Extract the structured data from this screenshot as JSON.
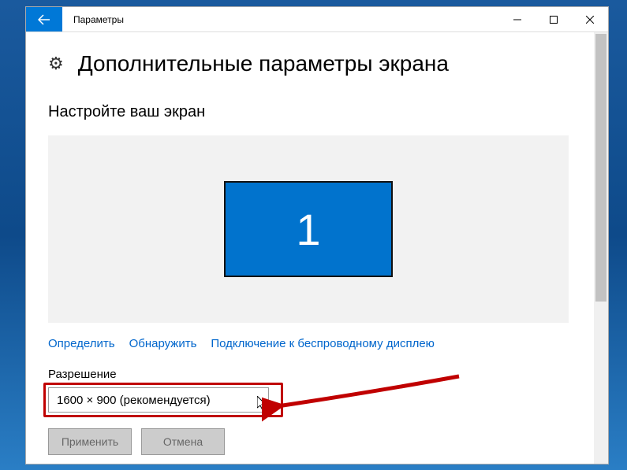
{
  "window": {
    "title": "Параметры"
  },
  "page": {
    "heading": "Дополнительные параметры экрана",
    "section_title": "Настройте ваш экран",
    "monitor_number": "1"
  },
  "links": {
    "identify": "Определить",
    "detect": "Обнаружить",
    "wireless": "Подключение к беспроводному дисплею"
  },
  "resolution": {
    "label": "Разрешение",
    "value": "1600 × 900 (рекомендуется)"
  },
  "buttons": {
    "apply": "Применить",
    "cancel": "Отмена"
  }
}
